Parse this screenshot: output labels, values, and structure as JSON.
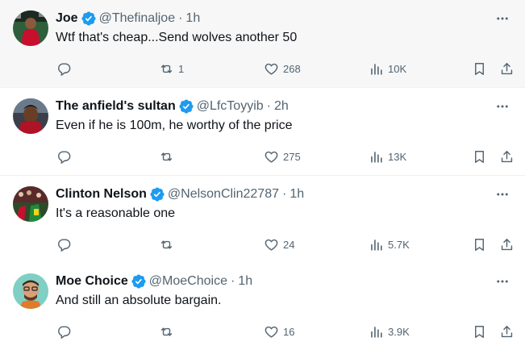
{
  "colors": {
    "text": "#0f1419",
    "muted": "#536471",
    "verified": "#1d9bf0",
    "divider": "#eff3f4",
    "hover_bg": "#f7f7f7"
  },
  "icons": {
    "verified": "verified-badge-icon",
    "more": "more-horizontal-icon",
    "reply": "reply-icon",
    "retweet": "retweet-icon",
    "like": "heart-icon",
    "views": "views-chart-icon",
    "bookmark": "bookmark-icon",
    "share": "share-icon"
  },
  "tweets": [
    {
      "name": "Joe",
      "handle": "@Thefinaljoe",
      "sep": "·",
      "time": "1h",
      "text": "Wtf that's cheap...Send wolves another 50",
      "replies": "",
      "retweets": "1",
      "likes": "268",
      "views": "10K"
    },
    {
      "name": "The anfield's sultan",
      "handle": "@LfcToyyib",
      "sep": "·",
      "time": "2h",
      "text": "Even if he is 100m, he worthy of the price",
      "replies": "",
      "retweets": "",
      "likes": "275",
      "views": "13K"
    },
    {
      "name": "Clinton Nelson",
      "handle": "@NelsonClin22787",
      "sep": "·",
      "time": "1h",
      "text": "It's a reasonable one",
      "replies": "",
      "retweets": "",
      "likes": "24",
      "views": "5.7K"
    },
    {
      "name": "Moe Choice",
      "handle": "@MoeChoice",
      "sep": "·",
      "time": "1h",
      "text": "And still an absolute bargain.",
      "replies": "",
      "retweets": "",
      "likes": "16",
      "views": "3.9K"
    }
  ]
}
